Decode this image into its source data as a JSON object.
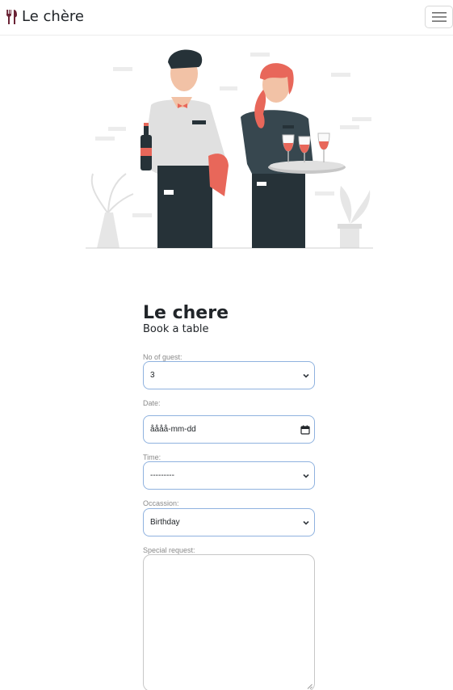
{
  "navbar": {
    "brand_icon": "fork-knife-icon",
    "brand_text": "Le chère",
    "toggler_icon": "hamburger-menu-icon"
  },
  "hero": {
    "image": "waiter-and-waitress-illustration"
  },
  "form": {
    "title": "Le chere",
    "subtitle": "Book a table",
    "guests": {
      "label": "No of guest:",
      "value": "3"
    },
    "date": {
      "label": "Date:",
      "value": "åååå-mm-dd"
    },
    "time": {
      "label": "Time:",
      "value": "---------"
    },
    "occasion": {
      "label": "Occassion:",
      "value": "Birthday"
    },
    "special_request": {
      "label": "Special request:",
      "value": ""
    }
  },
  "colors": {
    "field_border": "#8fb2df",
    "accent_red": "#e8675a",
    "dark_teal": "#263238",
    "brand_icon": "#6b2436"
  }
}
